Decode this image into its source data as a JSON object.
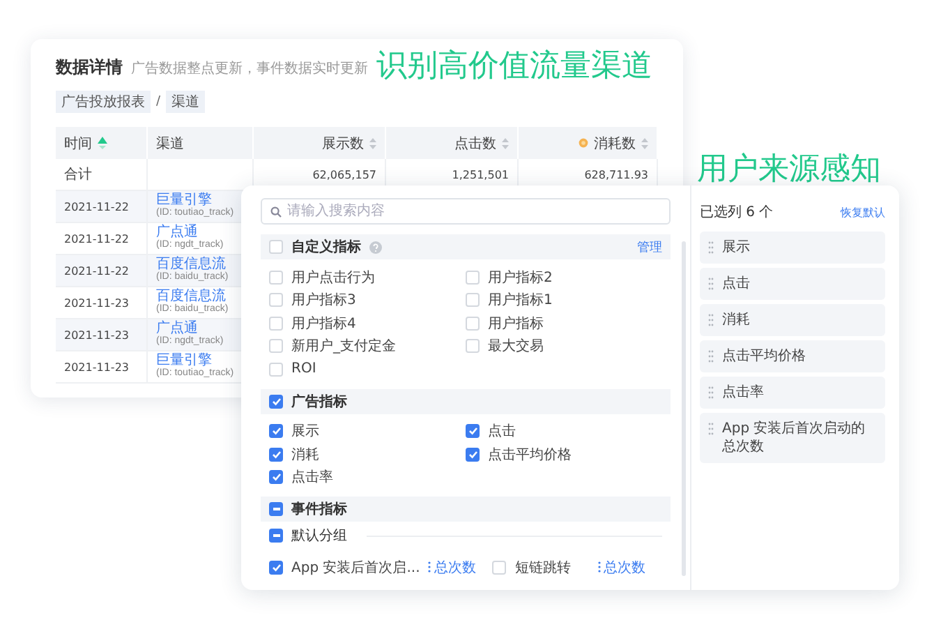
{
  "headline_left": "识别高价值流量渠道",
  "headline_right": "用户来源感知",
  "report": {
    "title": "数据详情",
    "subtitle": "广告数据整点更新，事件数据实时更新",
    "breadcrumb": [
      "广告投放报表",
      "渠道"
    ],
    "breadcrumb_separator": "/",
    "columns": [
      {
        "label": "时间",
        "sortable": true,
        "sorted": true
      },
      {
        "label": "渠道",
        "sortable": false
      },
      {
        "label": "展示数",
        "sortable": true,
        "sorted": false
      },
      {
        "label": "点击数",
        "sortable": true,
        "sorted": false
      },
      {
        "label": "消耗数",
        "sortable": true,
        "sorted": false
      }
    ],
    "total": {
      "label": "合计",
      "values": [
        "62,065,157",
        "1,251,501",
        "628,711.93"
      ]
    },
    "rows": [
      {
        "date": "2021-11-22",
        "channel": "巨量引擎",
        "channel_id": "(ID: toutiao_track)"
      },
      {
        "date": "2021-11-22",
        "channel": "广点通",
        "channel_id": "(ID: ngdt_track)"
      },
      {
        "date": "2021-11-22",
        "channel": "百度信息流",
        "channel_id": "(ID: baidu_track)"
      },
      {
        "date": "2021-11-23",
        "channel": "百度信息流",
        "channel_id": "(ID: baidu_track)"
      },
      {
        "date": "2021-11-23",
        "channel": "广点通",
        "channel_id": "(ID: ngdt_track)"
      },
      {
        "date": "2021-11-23",
        "channel": "巨量引擎",
        "channel_id": "(ID: toutiao_track)"
      }
    ]
  },
  "picker": {
    "search": {
      "placeholder": "请输入搜索内容"
    },
    "groups": [
      {
        "name": "自定义指标",
        "checked": false,
        "help": true,
        "action": "管理",
        "items": [
          {
            "label": "用户点击行为",
            "checked": false
          },
          {
            "label": "用户指标2",
            "checked": false
          },
          {
            "label": "用户指标3",
            "checked": false
          },
          {
            "label": "用户指标1",
            "checked": false
          },
          {
            "label": "用户指标4",
            "checked": false
          },
          {
            "label": "用户指标",
            "checked": false
          },
          {
            "label": "新用户_支付定金",
            "checked": false
          },
          {
            "label": "最大交易",
            "checked": false
          },
          {
            "label": "ROI",
            "checked": false
          }
        ]
      },
      {
        "name": "广告指标",
        "checked": true,
        "help": false,
        "items": [
          {
            "label": "展示",
            "checked": true
          },
          {
            "label": "点击",
            "checked": true
          },
          {
            "label": "消耗",
            "checked": true
          },
          {
            "label": "点击平均价格",
            "checked": true
          },
          {
            "label": "点击率",
            "checked": true
          }
        ]
      },
      {
        "name": "事件指标",
        "partial": true,
        "help": false,
        "subgroups": [
          {
            "name": "默认分组",
            "partial": true,
            "items": [
              {
                "label": "App 安装后首次启...",
                "checked": true,
                "metric": "总次数"
              },
              {
                "label": "短链跳转",
                "checked": false,
                "metric": "总次数"
              }
            ]
          }
        ]
      }
    ],
    "selected": {
      "title": "已选列 6 个",
      "reset": "恢复默认",
      "items": [
        "展示",
        "点击",
        "消耗",
        "点击平均价格",
        "点击率",
        "App 安装后首次启动的总次数"
      ]
    }
  }
}
